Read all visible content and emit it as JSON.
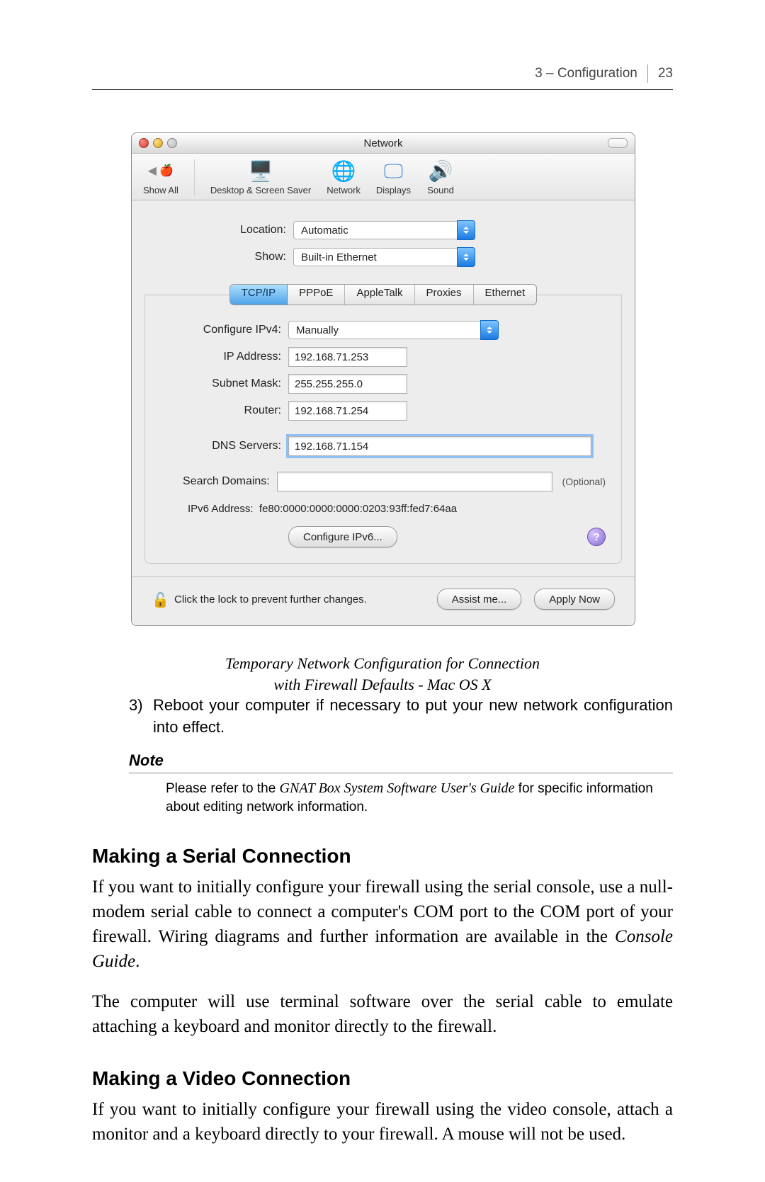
{
  "header": {
    "section": "3 – Configuration",
    "page_number": "23"
  },
  "window": {
    "title": "Network",
    "toolbar": {
      "show_all": "Show All",
      "items": [
        "Desktop & Screen Saver",
        "Network",
        "Displays",
        "Sound"
      ]
    },
    "location": {
      "label": "Location:",
      "value": "Automatic"
    },
    "show": {
      "label": "Show:",
      "value": "Built-in Ethernet"
    },
    "tabs": [
      "TCP/IP",
      "PPPoE",
      "AppleTalk",
      "Proxies",
      "Ethernet"
    ],
    "active_tab": "TCP/IP",
    "fields": {
      "configure_ipv4": {
        "label": "Configure IPv4:",
        "value": "Manually"
      },
      "ip_address": {
        "label": "IP Address:",
        "value": "192.168.71.253"
      },
      "subnet_mask": {
        "label": "Subnet Mask:",
        "value": "255.255.255.0"
      },
      "router": {
        "label": "Router:",
        "value": "192.168.71.254"
      },
      "dns_servers": {
        "label": "DNS Servers:",
        "value": "192.168.71.154"
      },
      "search_domains": {
        "label": "Search Domains:",
        "value": "",
        "optional": "(Optional)"
      },
      "ipv6_address": {
        "label": "IPv6 Address:",
        "value": "fe80:0000:0000:0000:0203:93ff:fed7:64aa"
      }
    },
    "configure_ipv6_btn": "Configure IPv6...",
    "footer": {
      "lock_text": "Click the lock to prevent further changes.",
      "assist_btn": "Assist me...",
      "apply_btn": "Apply Now"
    }
  },
  "caption_line1": "Temporary Network Configuration for Connection",
  "caption_line2": "with Firewall Defaults - Mac OS X",
  "step3_num": "3)",
  "step3": "Reboot your computer if necessary to put your new network configuration into effect.",
  "note_head": "Note",
  "note_pre": "Please refer to the ",
  "note_ital": "GNAT Box System Software User's Guide",
  "note_post": " for specific information about editing network information.",
  "serial_head": "Making a Serial Connection",
  "serial_p1a": "If you want to initially configure your firewall using the serial console, use a null-modem serial cable to connect a computer's COM port to the COM port of your firewall. Wiring diagrams and further information are available in the ",
  "serial_p1b": "Console Guide",
  "serial_p1c": ".",
  "serial_p2": "The computer will use terminal software over the serial cable to emulate attaching a keyboard and monitor directly to the firewall.",
  "video_head": "Making a Video Connection",
  "video_p1": "If you want to initially configure your firewall using the video console, attach a monitor and a keyboard directly to your firewall. A mouse will not be used."
}
